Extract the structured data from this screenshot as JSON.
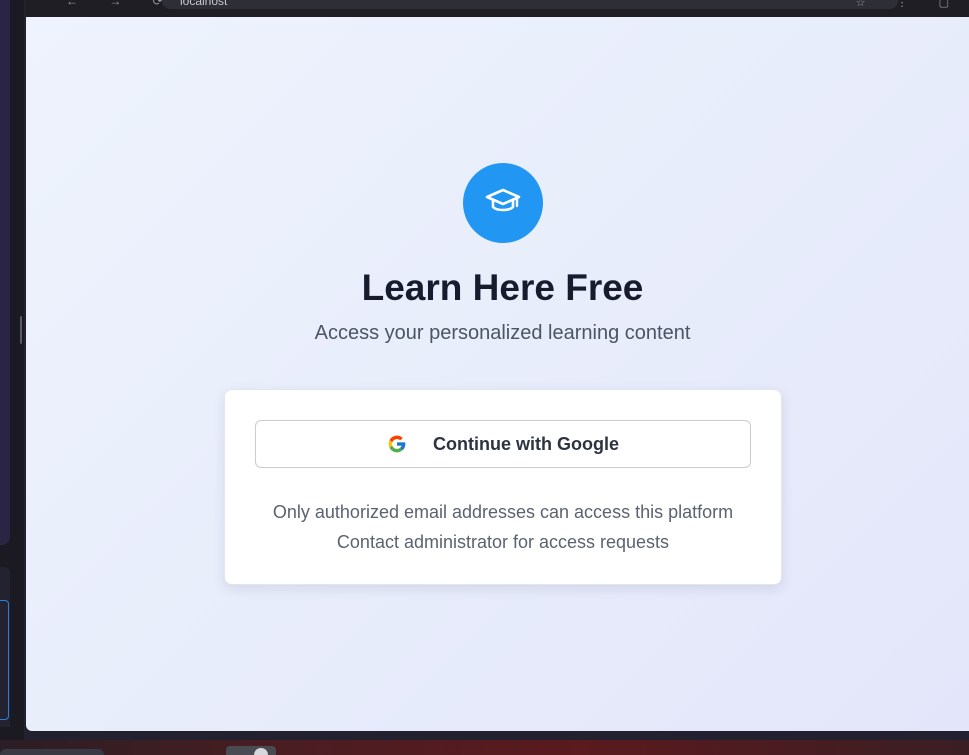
{
  "browser": {
    "address_text": "localhost",
    "nav_glyphs": "← → ⟳",
    "right_icons": "☆ ⋮ ▢"
  },
  "page": {
    "title": "Learn Here Free",
    "subtitle": "Access your personalized learning content",
    "logo_icon": "graduation-cap-icon",
    "accent_color": "#2196f3"
  },
  "login_card": {
    "google_button_label": "Continue with Google",
    "google_icon": "google-icon",
    "note_line_1": "Only authorized email addresses can access this platform",
    "note_line_2": "Contact administrator for access requests"
  }
}
